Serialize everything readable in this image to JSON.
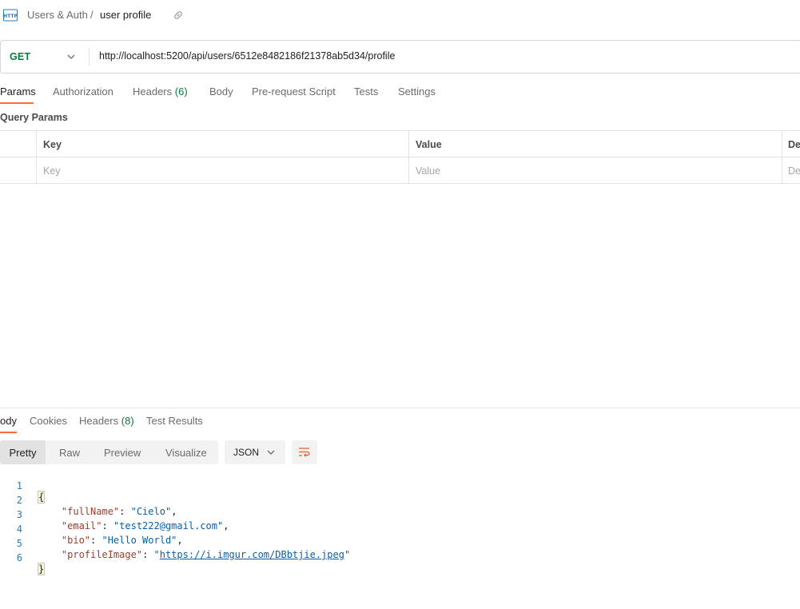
{
  "breadcrumb": {
    "collection": "Users & Auth",
    "separator": "/",
    "request_name": "user profile"
  },
  "request": {
    "method": "GET",
    "url": "http://localhost:5200/api/users/6512e8482186f21378ab5d34/profile"
  },
  "request_tabs": [
    {
      "label": "Params",
      "active": true
    },
    {
      "label": "Authorization"
    },
    {
      "label": "Headers",
      "count": "(6)"
    },
    {
      "label": "Body"
    },
    {
      "label": "Pre-request Script"
    },
    {
      "label": "Tests"
    },
    {
      "label": "Settings"
    }
  ],
  "query_params": {
    "title": "Query Params",
    "columns": [
      "Key",
      "Value",
      "De"
    ],
    "placeholders": [
      "Key",
      "Value",
      "De"
    ]
  },
  "response_tabs": [
    {
      "label": "ody",
      "active": true
    },
    {
      "label": "Cookies"
    },
    {
      "label": "Headers",
      "count": "(8)"
    },
    {
      "label": "Test Results"
    }
  ],
  "view_modes": [
    "Pretty",
    "Raw",
    "Preview",
    "Visualize"
  ],
  "active_view_mode": "Pretty",
  "format": "JSON",
  "response_body": {
    "line_numbers": [
      "1",
      "2",
      "3",
      "4",
      "5",
      "6"
    ],
    "open_brace": "{",
    "close_brace": "}",
    "fields": [
      {
        "key": "\"fullName\"",
        "value": "\"Cielo\"",
        "comma": ","
      },
      {
        "key": "\"email\"",
        "value": "\"test222@gmail.com\"",
        "comma": ","
      },
      {
        "key": "\"bio\"",
        "value": "\"Hello World\"",
        "comma": ","
      },
      {
        "key": "\"profileImage\"",
        "value": "https://i.imgur.com/DBbtjie.jpeg",
        "comma": ""
      }
    ]
  },
  "colors": {
    "accent": "#ff6c37",
    "method_get": "#0b7a3e",
    "json_key": "#9c3e2f",
    "json_string": "#0b5ea8"
  }
}
